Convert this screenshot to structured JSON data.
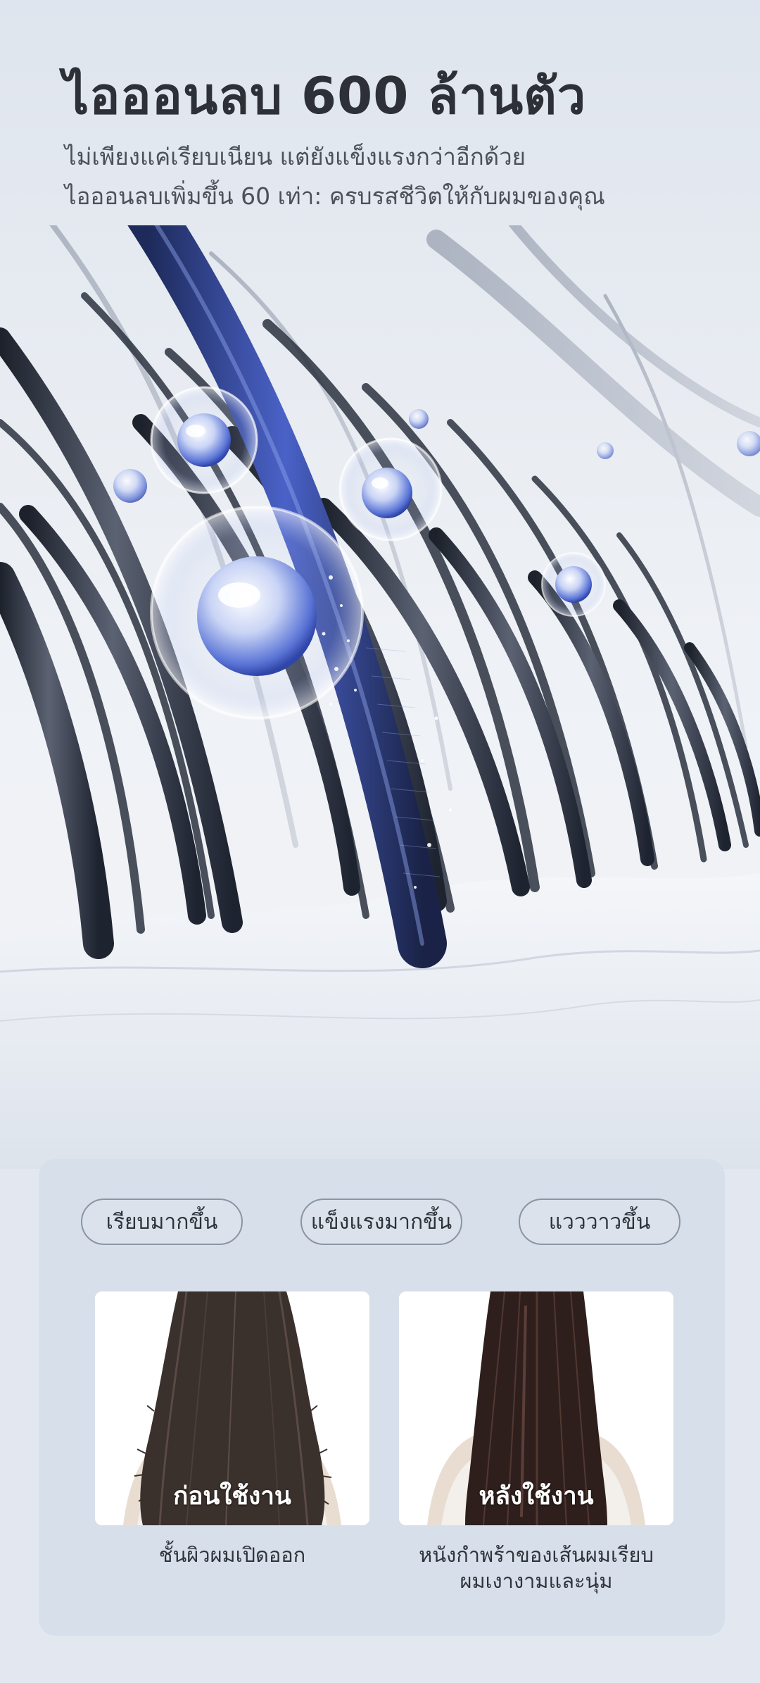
{
  "header": {
    "title": "ไอออนลบ 600 ล้านตัว",
    "subtitle_line1": "ไม่เพียงแค่เรียบเนียน แต่ยังแข็งแรงกว่าอีกด้วย",
    "subtitle_line2": "ไอออนลบเพิ่มขึ้น 60 เท่า: ครบรสชีวิตให้กับผมของคุณ"
  },
  "hero": {
    "illustration": "hair-strands-with-negative-ions",
    "accent_color": "#3f57c9",
    "strand_color": "#2a2f3a"
  },
  "comparison": {
    "tags": [
      "เรียบมากขึ้น",
      "แข็งแรงมากขึ้น",
      "แวววาวขึ้น"
    ],
    "before": {
      "label": "ก่อนใช้งาน",
      "caption": "ชั้นผิวผมเปิดออก"
    },
    "after": {
      "label": "หลังใช้งาน",
      "caption_line1": "หนังกำพร้าของเส้นผมเรียบ",
      "caption_line2": "ผมเงางามและนุ่ม"
    }
  }
}
